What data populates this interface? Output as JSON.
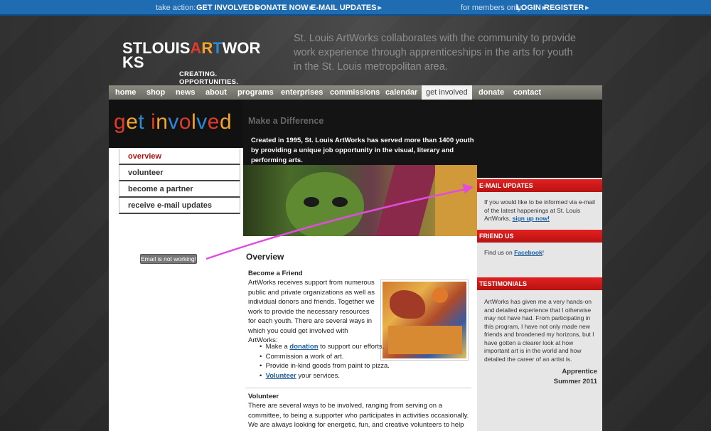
{
  "topbar": {
    "take_action_label": "take action:",
    "links": [
      "GET INVOLVED",
      "DONATE NOW",
      "E-MAIL UPDATES"
    ],
    "members_label": "for members only:",
    "member_links": [
      "LOGIN",
      "REGISTER"
    ]
  },
  "header": {
    "logo_text": "STLOUISARTWORKS",
    "logo_tagline": "CREATING. OPPORTUNITIES.",
    "tagline": "St. Louis ArtWorks collaborates with the community to provide work experience through apprenticeships in the arts for youth in the St. Louis metropolitan area."
  },
  "nav": {
    "items": [
      "home",
      "shop",
      "news",
      "about",
      "programs",
      "enterprises",
      "commissions",
      "calendar",
      "get involved",
      "donate",
      "contact"
    ],
    "active": "get involved"
  },
  "page_title": "get involved",
  "submenu": {
    "items": [
      "overview",
      "volunteer",
      "become a partner",
      "receive e-mail updates"
    ],
    "active": "overview"
  },
  "annotation": {
    "note": "Email is not working!",
    "color": "#e24be0"
  },
  "hero": {
    "heading": "Make a Difference",
    "text": "Created in 1995, St. Louis ArtWorks has served more than 1400 youth by providing a unique job opportunity in the visual, literary and performing arts."
  },
  "main": {
    "heading": "Overview",
    "friend_heading": "Become a Friend",
    "friend_text": "ArtWorks receives support from numerous public and private organizations as well as individual donors and friends. Together we work to provide the necessary resources for each youth. There are several ways in which you could get involved with ArtWorks:",
    "bullets": [
      {
        "pre": "Make a ",
        "link": "donation",
        "post": " to support our efforts."
      },
      {
        "pre": "Commission a work of art.",
        "link": "",
        "post": ""
      },
      {
        "pre": "Provide in-kind goods from paint to pizza.",
        "link": "",
        "post": ""
      },
      {
        "pre": "",
        "link": "Volunteer",
        "post": " your services."
      }
    ],
    "volunteer_heading": "Volunteer",
    "volunteer_text": "There are several ways to be involved, ranging from serving on a committee, to being a supporter who participates in activities occasionally. We are always looking for energetic, fun, and creative volunteers to help us with our projects and"
  },
  "sidebar": {
    "email_heading": "E-MAIL UPDATES",
    "email_text": "If you would like to be informed via e-mail of the latest happenings at St. Louis ArtWorks,",
    "email_link": "sign up now!",
    "friend_heading": "FRIEND US",
    "friend_text": "Find us on",
    "friend_link": "Facebook",
    "friend_after": "!",
    "testimonials_heading": "TESTIMONIALS",
    "testimonial_text": "ArtWorks has given me a very hands-on and detailed experience that I otherwise may not have had. From participating in this program, I have not only made new friends and broadened my horizons, but I have gotten a clearer look at how important art is in the world and how detailed the career of an artist is.",
    "testimonial_author": "Apprentice",
    "testimonial_date": "Summer 2011"
  },
  "colors": {
    "topbar": "#1f6cb3",
    "accent_red": "#d81818",
    "link_blue": "#1a5c9e"
  }
}
